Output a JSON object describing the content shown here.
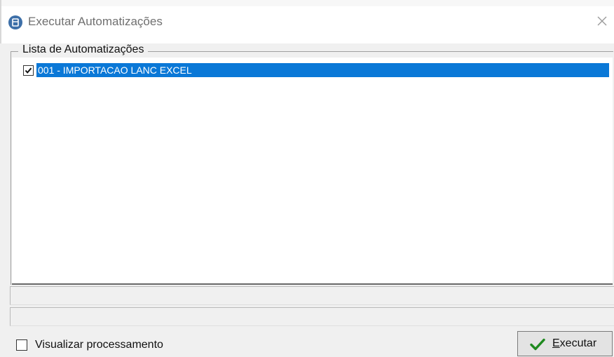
{
  "window": {
    "title": "Executar Automatizações",
    "icon": "app-window-icon",
    "close_icon": "close-icon"
  },
  "group": {
    "title": "Lista de Automatizações"
  },
  "list": {
    "items": [
      {
        "label": "001 - IMPORTACAO LANC EXCEL",
        "checked": true,
        "selected": true
      }
    ]
  },
  "options": {
    "visualizar_label": "Visualizar processamento",
    "visualizar_checked": false
  },
  "actions": {
    "executar_mnemonic": "E",
    "executar_rest": "xecutar",
    "executar_icon": "checkmark-icon"
  },
  "colors": {
    "selection": "#0a78d7",
    "check_icon": "#1f8a1f",
    "app_icon": "#3d6fa8"
  }
}
